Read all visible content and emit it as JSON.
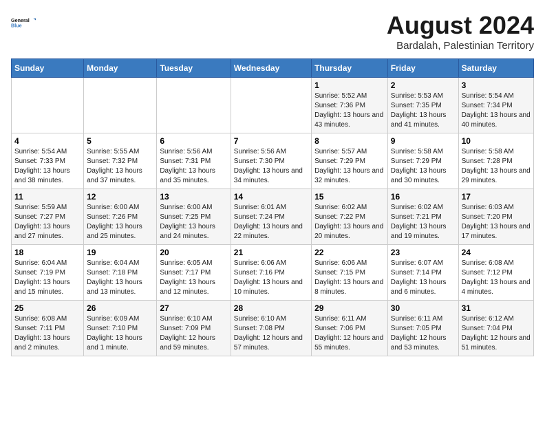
{
  "logo": {
    "line1": "General",
    "line2": "Blue"
  },
  "title": "August 2024",
  "subtitle": "Bardalah, Palestinian Territory",
  "days_of_week": [
    "Sunday",
    "Monday",
    "Tuesday",
    "Wednesday",
    "Thursday",
    "Friday",
    "Saturday"
  ],
  "weeks": [
    [
      {
        "day": "",
        "sunrise": "",
        "sunset": "",
        "daylight": ""
      },
      {
        "day": "",
        "sunrise": "",
        "sunset": "",
        "daylight": ""
      },
      {
        "day": "",
        "sunrise": "",
        "sunset": "",
        "daylight": ""
      },
      {
        "day": "",
        "sunrise": "",
        "sunset": "",
        "daylight": ""
      },
      {
        "day": "1",
        "sunrise": "Sunrise: 5:52 AM",
        "sunset": "Sunset: 7:36 PM",
        "daylight": "Daylight: 13 hours and 43 minutes."
      },
      {
        "day": "2",
        "sunrise": "Sunrise: 5:53 AM",
        "sunset": "Sunset: 7:35 PM",
        "daylight": "Daylight: 13 hours and 41 minutes."
      },
      {
        "day": "3",
        "sunrise": "Sunrise: 5:54 AM",
        "sunset": "Sunset: 7:34 PM",
        "daylight": "Daylight: 13 hours and 40 minutes."
      }
    ],
    [
      {
        "day": "4",
        "sunrise": "Sunrise: 5:54 AM",
        "sunset": "Sunset: 7:33 PM",
        "daylight": "Daylight: 13 hours and 38 minutes."
      },
      {
        "day": "5",
        "sunrise": "Sunrise: 5:55 AM",
        "sunset": "Sunset: 7:32 PM",
        "daylight": "Daylight: 13 hours and 37 minutes."
      },
      {
        "day": "6",
        "sunrise": "Sunrise: 5:56 AM",
        "sunset": "Sunset: 7:31 PM",
        "daylight": "Daylight: 13 hours and 35 minutes."
      },
      {
        "day": "7",
        "sunrise": "Sunrise: 5:56 AM",
        "sunset": "Sunset: 7:30 PM",
        "daylight": "Daylight: 13 hours and 34 minutes."
      },
      {
        "day": "8",
        "sunrise": "Sunrise: 5:57 AM",
        "sunset": "Sunset: 7:29 PM",
        "daylight": "Daylight: 13 hours and 32 minutes."
      },
      {
        "day": "9",
        "sunrise": "Sunrise: 5:58 AM",
        "sunset": "Sunset: 7:29 PM",
        "daylight": "Daylight: 13 hours and 30 minutes."
      },
      {
        "day": "10",
        "sunrise": "Sunrise: 5:58 AM",
        "sunset": "Sunset: 7:28 PM",
        "daylight": "Daylight: 13 hours and 29 minutes."
      }
    ],
    [
      {
        "day": "11",
        "sunrise": "Sunrise: 5:59 AM",
        "sunset": "Sunset: 7:27 PM",
        "daylight": "Daylight: 13 hours and 27 minutes."
      },
      {
        "day": "12",
        "sunrise": "Sunrise: 6:00 AM",
        "sunset": "Sunset: 7:26 PM",
        "daylight": "Daylight: 13 hours and 25 minutes."
      },
      {
        "day": "13",
        "sunrise": "Sunrise: 6:00 AM",
        "sunset": "Sunset: 7:25 PM",
        "daylight": "Daylight: 13 hours and 24 minutes."
      },
      {
        "day": "14",
        "sunrise": "Sunrise: 6:01 AM",
        "sunset": "Sunset: 7:24 PM",
        "daylight": "Daylight: 13 hours and 22 minutes."
      },
      {
        "day": "15",
        "sunrise": "Sunrise: 6:02 AM",
        "sunset": "Sunset: 7:22 PM",
        "daylight": "Daylight: 13 hours and 20 minutes."
      },
      {
        "day": "16",
        "sunrise": "Sunrise: 6:02 AM",
        "sunset": "Sunset: 7:21 PM",
        "daylight": "Daylight: 13 hours and 19 minutes."
      },
      {
        "day": "17",
        "sunrise": "Sunrise: 6:03 AM",
        "sunset": "Sunset: 7:20 PM",
        "daylight": "Daylight: 13 hours and 17 minutes."
      }
    ],
    [
      {
        "day": "18",
        "sunrise": "Sunrise: 6:04 AM",
        "sunset": "Sunset: 7:19 PM",
        "daylight": "Daylight: 13 hours and 15 minutes."
      },
      {
        "day": "19",
        "sunrise": "Sunrise: 6:04 AM",
        "sunset": "Sunset: 7:18 PM",
        "daylight": "Daylight: 13 hours and 13 minutes."
      },
      {
        "day": "20",
        "sunrise": "Sunrise: 6:05 AM",
        "sunset": "Sunset: 7:17 PM",
        "daylight": "Daylight: 13 hours and 12 minutes."
      },
      {
        "day": "21",
        "sunrise": "Sunrise: 6:06 AM",
        "sunset": "Sunset: 7:16 PM",
        "daylight": "Daylight: 13 hours and 10 minutes."
      },
      {
        "day": "22",
        "sunrise": "Sunrise: 6:06 AM",
        "sunset": "Sunset: 7:15 PM",
        "daylight": "Daylight: 13 hours and 8 minutes."
      },
      {
        "day": "23",
        "sunrise": "Sunrise: 6:07 AM",
        "sunset": "Sunset: 7:14 PM",
        "daylight": "Daylight: 13 hours and 6 minutes."
      },
      {
        "day": "24",
        "sunrise": "Sunrise: 6:08 AM",
        "sunset": "Sunset: 7:12 PM",
        "daylight": "Daylight: 13 hours and 4 minutes."
      }
    ],
    [
      {
        "day": "25",
        "sunrise": "Sunrise: 6:08 AM",
        "sunset": "Sunset: 7:11 PM",
        "daylight": "Daylight: 13 hours and 2 minutes."
      },
      {
        "day": "26",
        "sunrise": "Sunrise: 6:09 AM",
        "sunset": "Sunset: 7:10 PM",
        "daylight": "Daylight: 13 hours and 1 minute."
      },
      {
        "day": "27",
        "sunrise": "Sunrise: 6:10 AM",
        "sunset": "Sunset: 7:09 PM",
        "daylight": "Daylight: 12 hours and 59 minutes."
      },
      {
        "day": "28",
        "sunrise": "Sunrise: 6:10 AM",
        "sunset": "Sunset: 7:08 PM",
        "daylight": "Daylight: 12 hours and 57 minutes."
      },
      {
        "day": "29",
        "sunrise": "Sunrise: 6:11 AM",
        "sunset": "Sunset: 7:06 PM",
        "daylight": "Daylight: 12 hours and 55 minutes."
      },
      {
        "day": "30",
        "sunrise": "Sunrise: 6:11 AM",
        "sunset": "Sunset: 7:05 PM",
        "daylight": "Daylight: 12 hours and 53 minutes."
      },
      {
        "day": "31",
        "sunrise": "Sunrise: 6:12 AM",
        "sunset": "Sunset: 7:04 PM",
        "daylight": "Daylight: 12 hours and 51 minutes."
      }
    ]
  ]
}
